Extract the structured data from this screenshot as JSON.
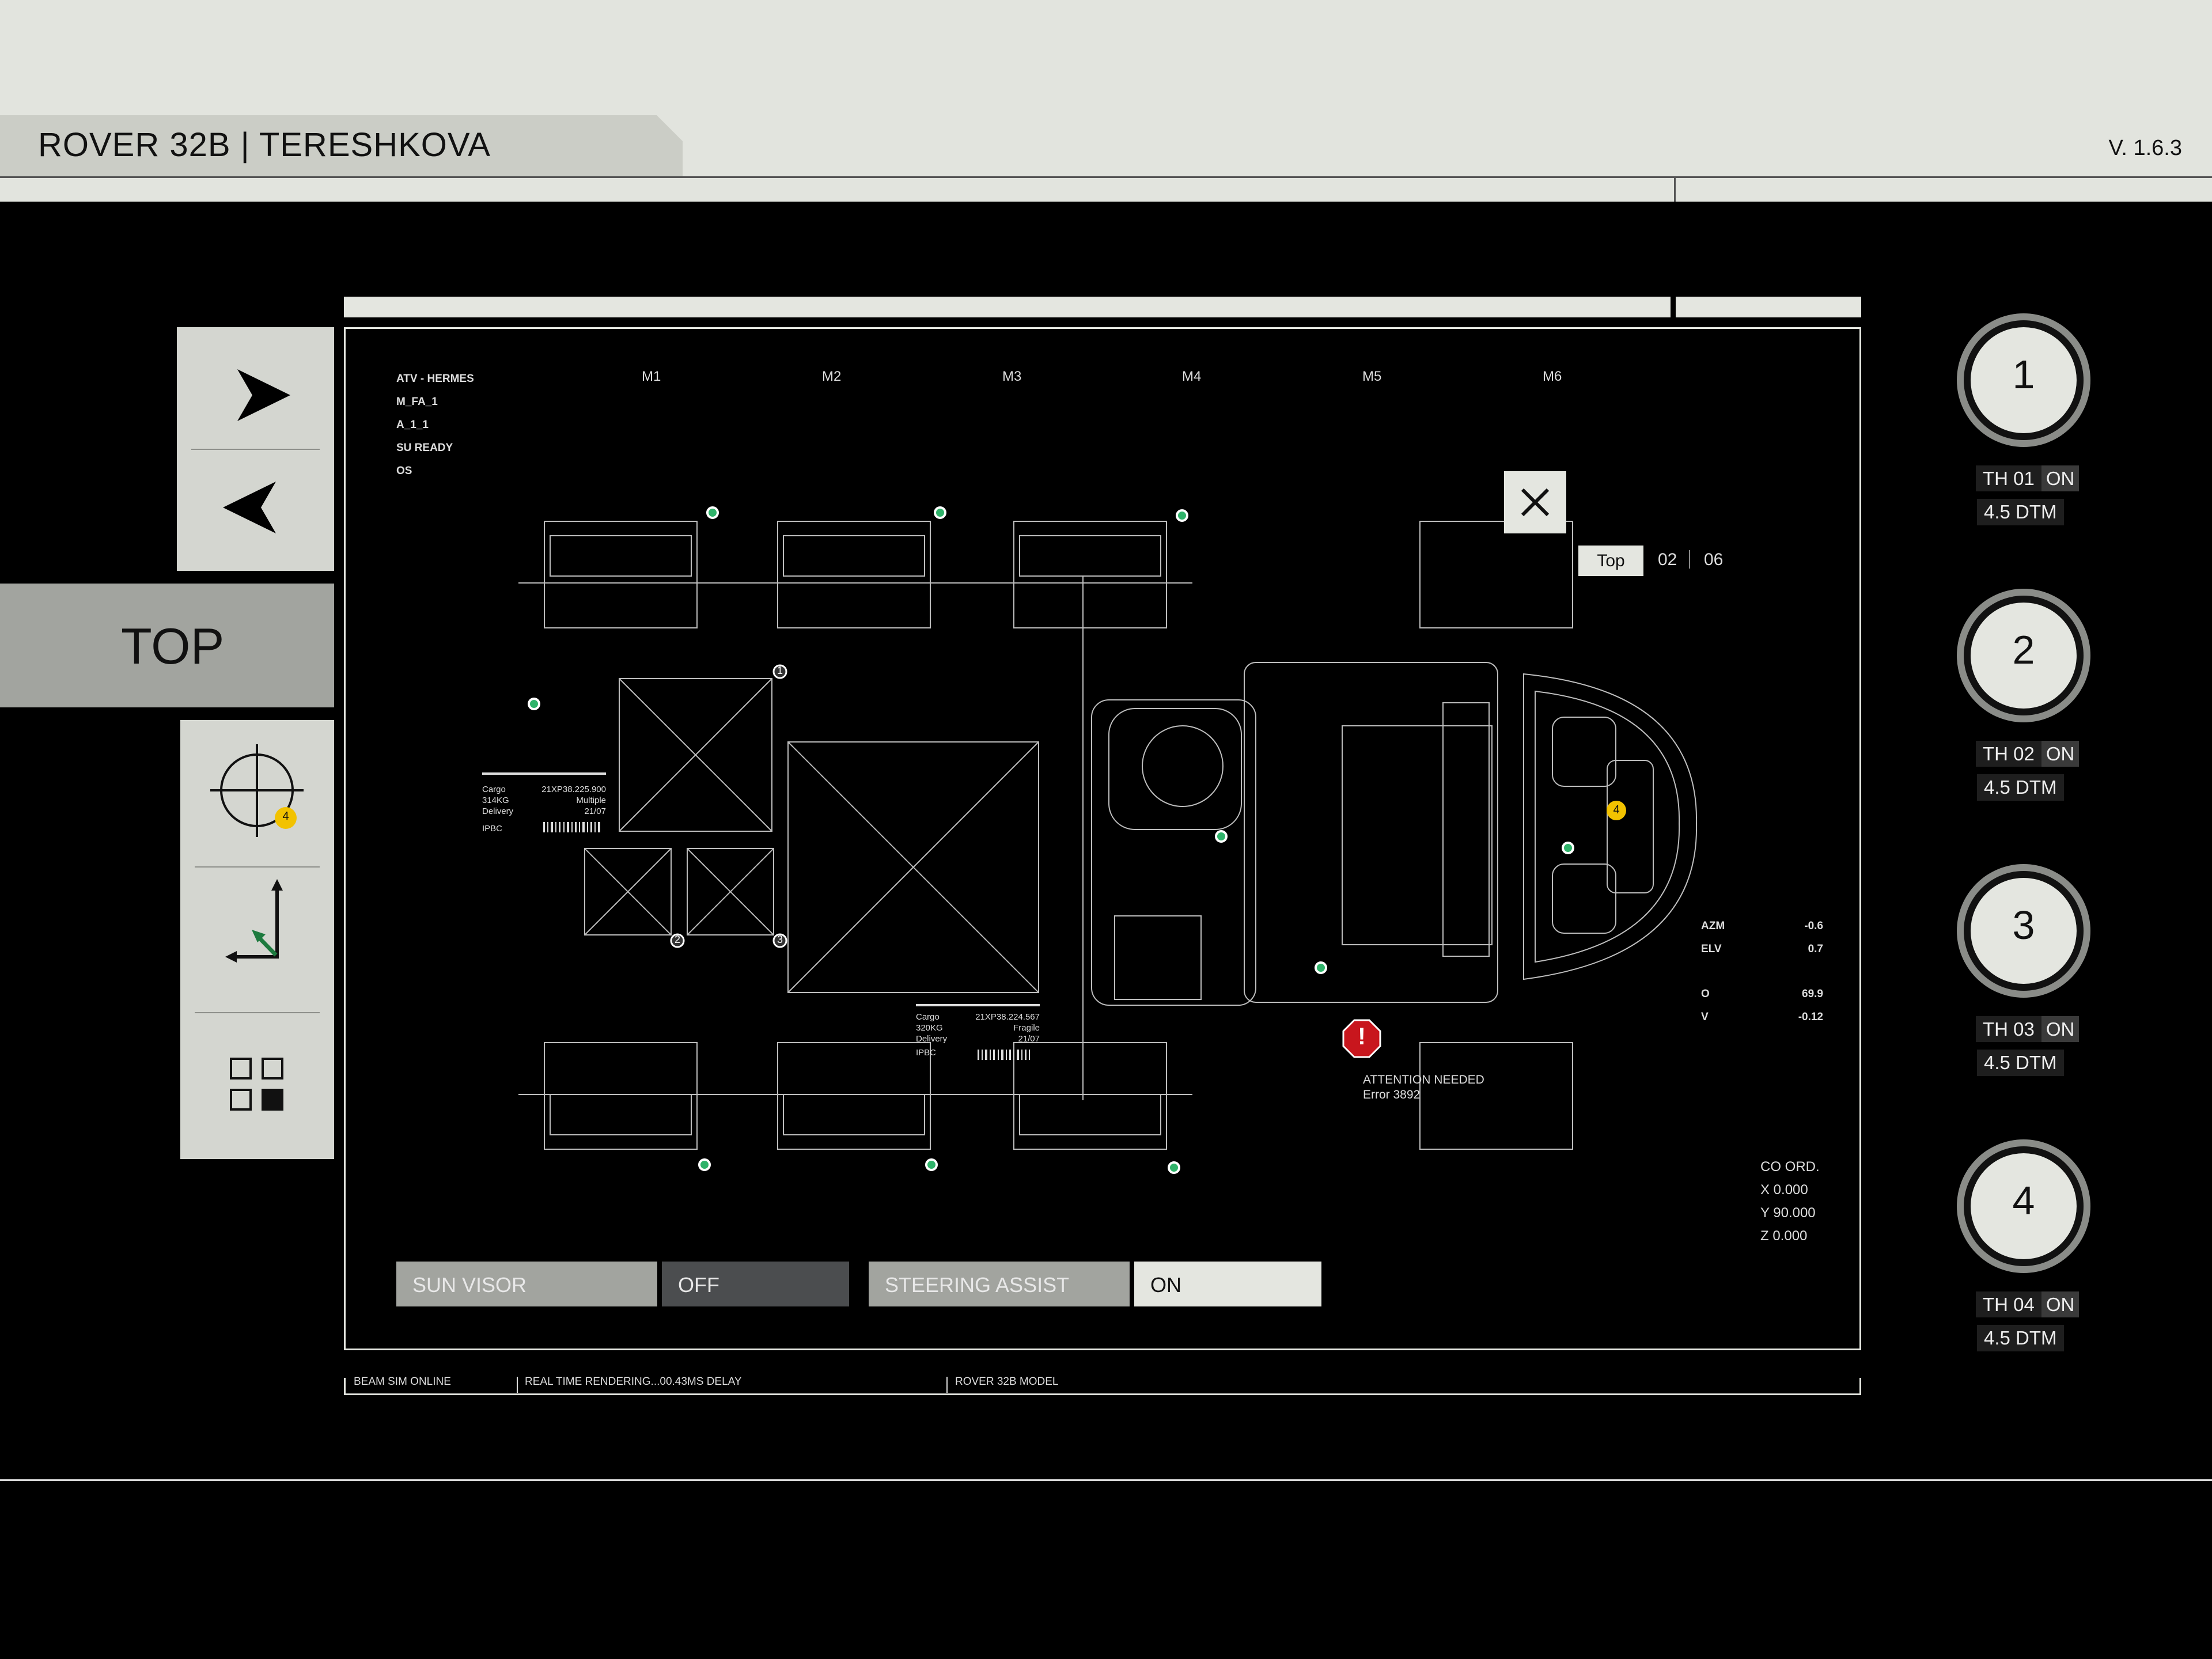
{
  "app": {
    "title": "ROVER 32B | TERESHKOVA",
    "version": "V. 1.6.3"
  },
  "nav": {
    "view_label": "TOP",
    "target_badge": "4"
  },
  "vehicle": {
    "labels": [
      "ATV - HERMES",
      "M_FA_1",
      "A_1_1",
      "SU READY",
      "OS"
    ]
  },
  "modules": [
    "M1",
    "M2",
    "M3",
    "M4",
    "M5",
    "M6"
  ],
  "view_selector": {
    "view": "Top",
    "current": "02",
    "total": "06"
  },
  "cargo": {
    "a": {
      "cargo": "Cargo",
      "weight": "314KG",
      "type": "Delivery",
      "code": "21XP38.225.900",
      "note": "Multiple",
      "date": "21/07",
      "tag": "IPBC"
    },
    "b": {
      "cargo": "Cargo",
      "weight": "320KG",
      "type": "Delivery",
      "code": "21XP38.224.567",
      "note": "Fragile",
      "date": "21/07",
      "tag": "IPBC"
    }
  },
  "markers": [
    "1",
    "2",
    "3"
  ],
  "hotspot_badge": "4",
  "alert": {
    "title": "ATTENTION NEEDED",
    "code": "Error 3892"
  },
  "telemetry": [
    {
      "label": "AZM",
      "value": "-0.6"
    },
    {
      "label": "ELV",
      "value": "0.7"
    },
    {
      "label": "O",
      "value": "69.9"
    },
    {
      "label": "V",
      "value": "-0.12"
    }
  ],
  "coords": {
    "title": "CO ORD.",
    "x": "X 0.000",
    "y": "Y 90.000",
    "z": "Z 0.000"
  },
  "toggles": [
    {
      "label": "SUN VISOR",
      "state": "OFF"
    },
    {
      "label": "STEERING ASSIST",
      "state": "ON"
    }
  ],
  "status_bar": [
    "BEAM SIM ONLINE",
    "REAL TIME RENDERING...00.43MS DELAY",
    "ROVER 32B MODEL"
  ],
  "thrusters": [
    {
      "num": "1",
      "name": "TH 01",
      "state": "ON",
      "value": "4.5 DTM"
    },
    {
      "num": "2",
      "name": "TH 02",
      "state": "ON",
      "value": "4.5 DTM"
    },
    {
      "num": "3",
      "name": "TH 03",
      "state": "ON",
      "value": "4.5 DTM"
    },
    {
      "num": "4",
      "name": "TH 04",
      "state": "ON",
      "value": "4.5 DTM"
    }
  ],
  "colors": {
    "accent_green": "#2fb36a",
    "badge_yellow": "#f2c200",
    "alert_red": "#c8161d",
    "panel_light": "#e2e4de"
  }
}
